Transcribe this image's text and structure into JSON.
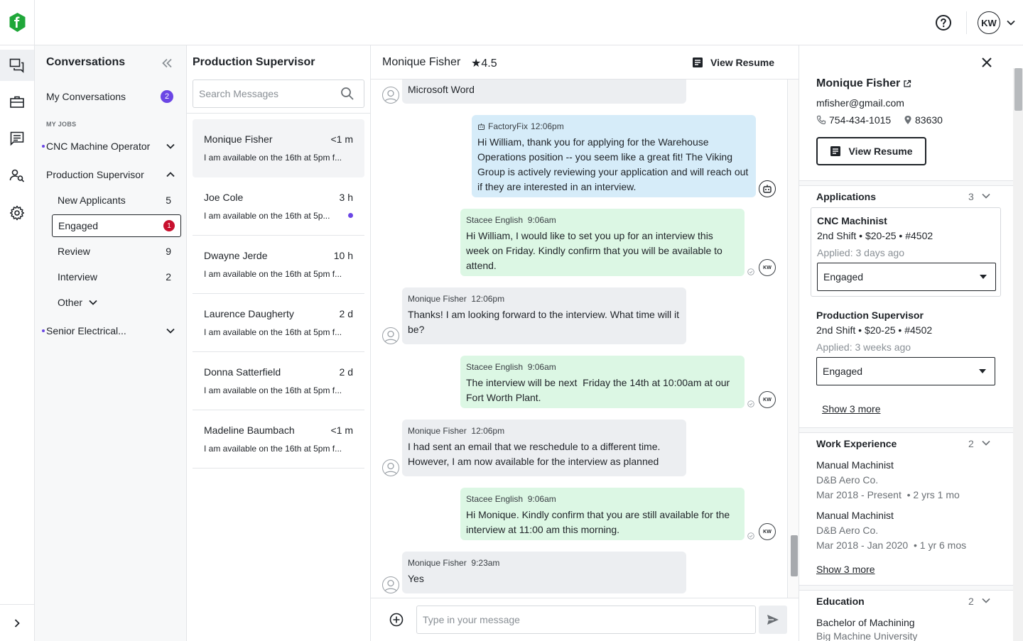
{
  "colors": {
    "brand": "#1fa739",
    "accent": "#6b46e5",
    "alert": "#c8102e"
  },
  "topbar": {
    "avatar_initials": "KW",
    "icons": [
      "logo-icon",
      "help-icon",
      "chevron-down-icon"
    ]
  },
  "rail": {
    "icons": [
      "conversations-icon",
      "jobs-icon",
      "messages-icon",
      "candidate-search-icon",
      "settings-icon",
      "chevron-right-icon"
    ]
  },
  "sidebar": {
    "title": "Conversations",
    "my_conversations": {
      "label": "My Conversations",
      "count": "2"
    },
    "section_label": "MY JOBS",
    "jobs": [
      {
        "label": "CNC Machine Operator"
      },
      {
        "label": "Production Supervisor"
      },
      {
        "label": "Senior Electrical..."
      }
    ],
    "stages": [
      {
        "label": "New Applicants",
        "count": "5"
      },
      {
        "label": "Engaged",
        "count": "1"
      },
      {
        "label": "Review",
        "count": "9"
      },
      {
        "label": "Interview",
        "count": "2"
      },
      {
        "label": "Other"
      }
    ]
  },
  "convlist": {
    "title": "Production Supervisor",
    "search_placeholder": "Search Messages",
    "items": [
      {
        "name": "Monique Fisher",
        "time": "<1 m",
        "preview": "I am available on the 16th at 5pm f..."
      },
      {
        "name": "Joe Cole",
        "time": "3 h",
        "preview": "I am available on the 16th at 5p..."
      },
      {
        "name": "Dwayne Jerde",
        "time": "10 h",
        "preview": "I am available on the 16th at 5pm f..."
      },
      {
        "name": "Laurence Daugherty",
        "time": "2 d",
        "preview": "I am available on the 16th at 5pm f..."
      },
      {
        "name": "Donna Satterfield",
        "time": "2 d",
        "preview": "I am available on the 16th at 5pm f..."
      },
      {
        "name": "Madeline Baumbach",
        "time": "<1 m",
        "preview": "I am available on the 16th at 5pm f..."
      }
    ]
  },
  "chat": {
    "name": "Monique Fisher",
    "rating": "★4.5",
    "view_resume": "View Resume",
    "composer_placeholder": "Type in your message",
    "messages": [
      {
        "text": "Microsoft Word"
      },
      {
        "sender": "FactoryFix",
        "time": "12:06pm",
        "text": "Hi William, thank you for applying for the Warehouse Operations position -- you seem like a great fit! The Viking Group is actively reviewing your application and will reach out if they are interested in an interview."
      },
      {
        "sender": "Stacee English",
        "time": "9:06am",
        "text": "Hi William, I would like to set you up for an interview this week on Friday. Kindly confirm that you will be available to attend."
      },
      {
        "sender": "Monique Fisher",
        "time": "12:06pm",
        "text": "Thanks! I am looking forward to the interview. What time will it be?"
      },
      {
        "sender": "Stacee English",
        "time": "9:06am",
        "text": "The interview will be next  Friday the 14th at 10:00am at our Fort Worth Plant."
      },
      {
        "sender": "Monique Fisher",
        "time": "12:06pm",
        "text": "I had sent an email that we reschedule to a different time. However, I am now available for the interview as planned"
      },
      {
        "sender": "Stacee English",
        "time": "9:06am",
        "text": "Hi Monique. Kindly confirm that you are still available for the interview at 11:00 am this morning."
      },
      {
        "sender": "Monique Fisher",
        "time": "9:23am",
        "text": "Yes"
      }
    ]
  },
  "panel": {
    "name": "Monique Fisher",
    "email": "mfisher@gmail.com",
    "phone": "754-434-1015",
    "zip": "83630",
    "view_resume": "View Resume",
    "applications": {
      "title": "Applications",
      "count": "3",
      "items": [
        {
          "title": "CNC Machinist",
          "meta": "2nd Shift • $20-25 • #4502",
          "applied": "Applied: 3 days ago",
          "status": "Engaged"
        },
        {
          "title": "Production Supervisor",
          "meta": "2nd Shift • $20-25 • #4502",
          "applied": "Applied: 3 weeks ago",
          "status": "Engaged"
        }
      ],
      "more": "Show 3 more"
    },
    "experience": {
      "title": "Work Experience",
      "count": "2",
      "items": [
        {
          "title": "Manual Machinist",
          "company": "D&B Aero Co.",
          "dates": "Mar 2018 - Present",
          "duration": "2 yrs 1 mo"
        },
        {
          "title": "Manual Machinist",
          "company": "D&B Aero Co.",
          "dates": "Mar 2018 - Jan 2020",
          "duration": "1 yr 6 mos"
        }
      ],
      "more": "Show 3 more"
    },
    "education": {
      "title": "Education",
      "count": "2",
      "items": [
        {
          "title": "Bachelor of Machining",
          "school": "Big Machine University"
        }
      ]
    }
  }
}
